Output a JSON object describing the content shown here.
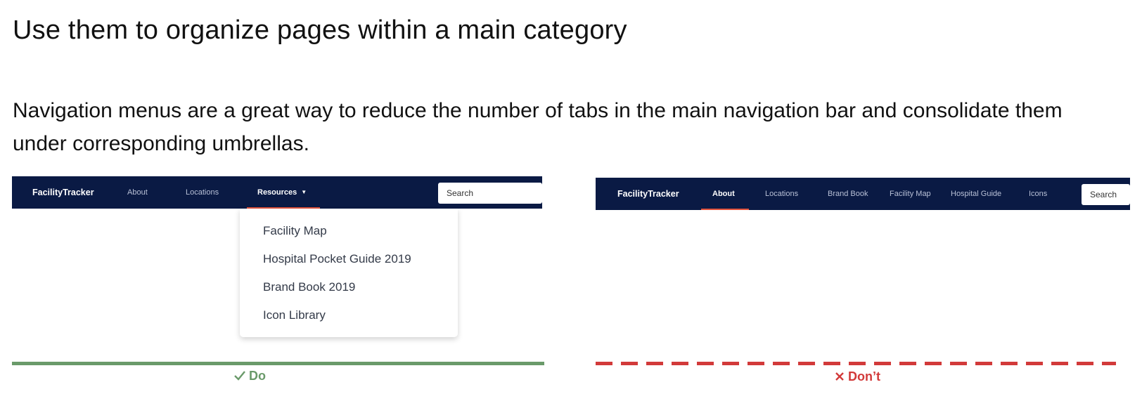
{
  "heading": "Use them to organize pages within a main category",
  "description": "Navigation menus are a great way to reduce the number of tabs in the main navigation bar and consolidate them under corresponding umbrellas.",
  "colors": {
    "navbar": "#0a1a44",
    "active_underline": "#e0523c",
    "do": "#6a9a6a",
    "dont": "#d23a3a"
  },
  "do_example": {
    "brand": "FacilityTracker",
    "nav": {
      "about": "About",
      "locations": "Locations",
      "resources": "Resources"
    },
    "active_tab": "Resources",
    "search_placeholder": "Search",
    "dropdown_items": [
      "Facility Map",
      "Hospital Pocket Guide 2019",
      "Brand Book 2019",
      "Icon Library"
    ],
    "indicator_icon": "check-icon",
    "indicator_label": "Do"
  },
  "dont_example": {
    "brand": "FacilityTracker",
    "nav": {
      "about": "About",
      "locations": "Locations",
      "brand_book": "Brand Book",
      "facility_map": "Facility Map",
      "hospital_guide": "Hospital Guide",
      "icons": "Icons"
    },
    "active_tab": "About",
    "search_placeholder": "Search",
    "indicator_icon": "x-icon",
    "indicator_label": "Don’t"
  }
}
